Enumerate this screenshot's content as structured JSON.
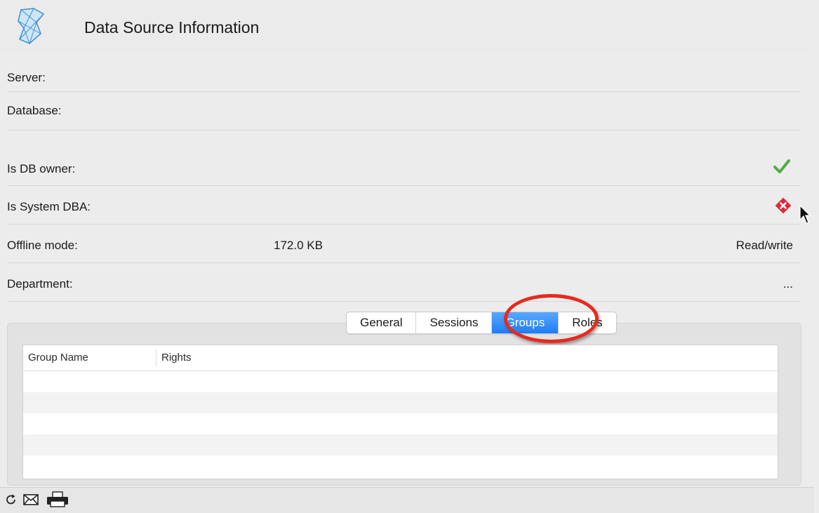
{
  "window": {
    "title": "Data Source Information"
  },
  "fields": {
    "server_label": "Server:",
    "database_label": "Database:",
    "db_owner_label": "Is DB owner:",
    "system_dba_label": "Is System DBA:",
    "offline_label": "Offline mode:",
    "offline_size": "172.0 KB",
    "offline_access": "Read/write",
    "department_label": "Department:",
    "department_more": "..."
  },
  "status": {
    "db_owner": "check-icon",
    "system_dba": "error-icon",
    "check_color": "#4caf3d",
    "error_color": "#e0293a"
  },
  "tabs": {
    "general": "General",
    "sessions": "Sessions",
    "groups": "Groups",
    "roles": "Roles",
    "selected": "Groups"
  },
  "groups_table": {
    "col_group_name": "Group Name",
    "col_rights": "Rights"
  },
  "toolbar": {
    "refresh": "refresh-icon",
    "email": "mail-icon",
    "print": "print-icon"
  },
  "colors": {
    "accent": "#1f7cf5",
    "highlight": "#e62a1d"
  }
}
